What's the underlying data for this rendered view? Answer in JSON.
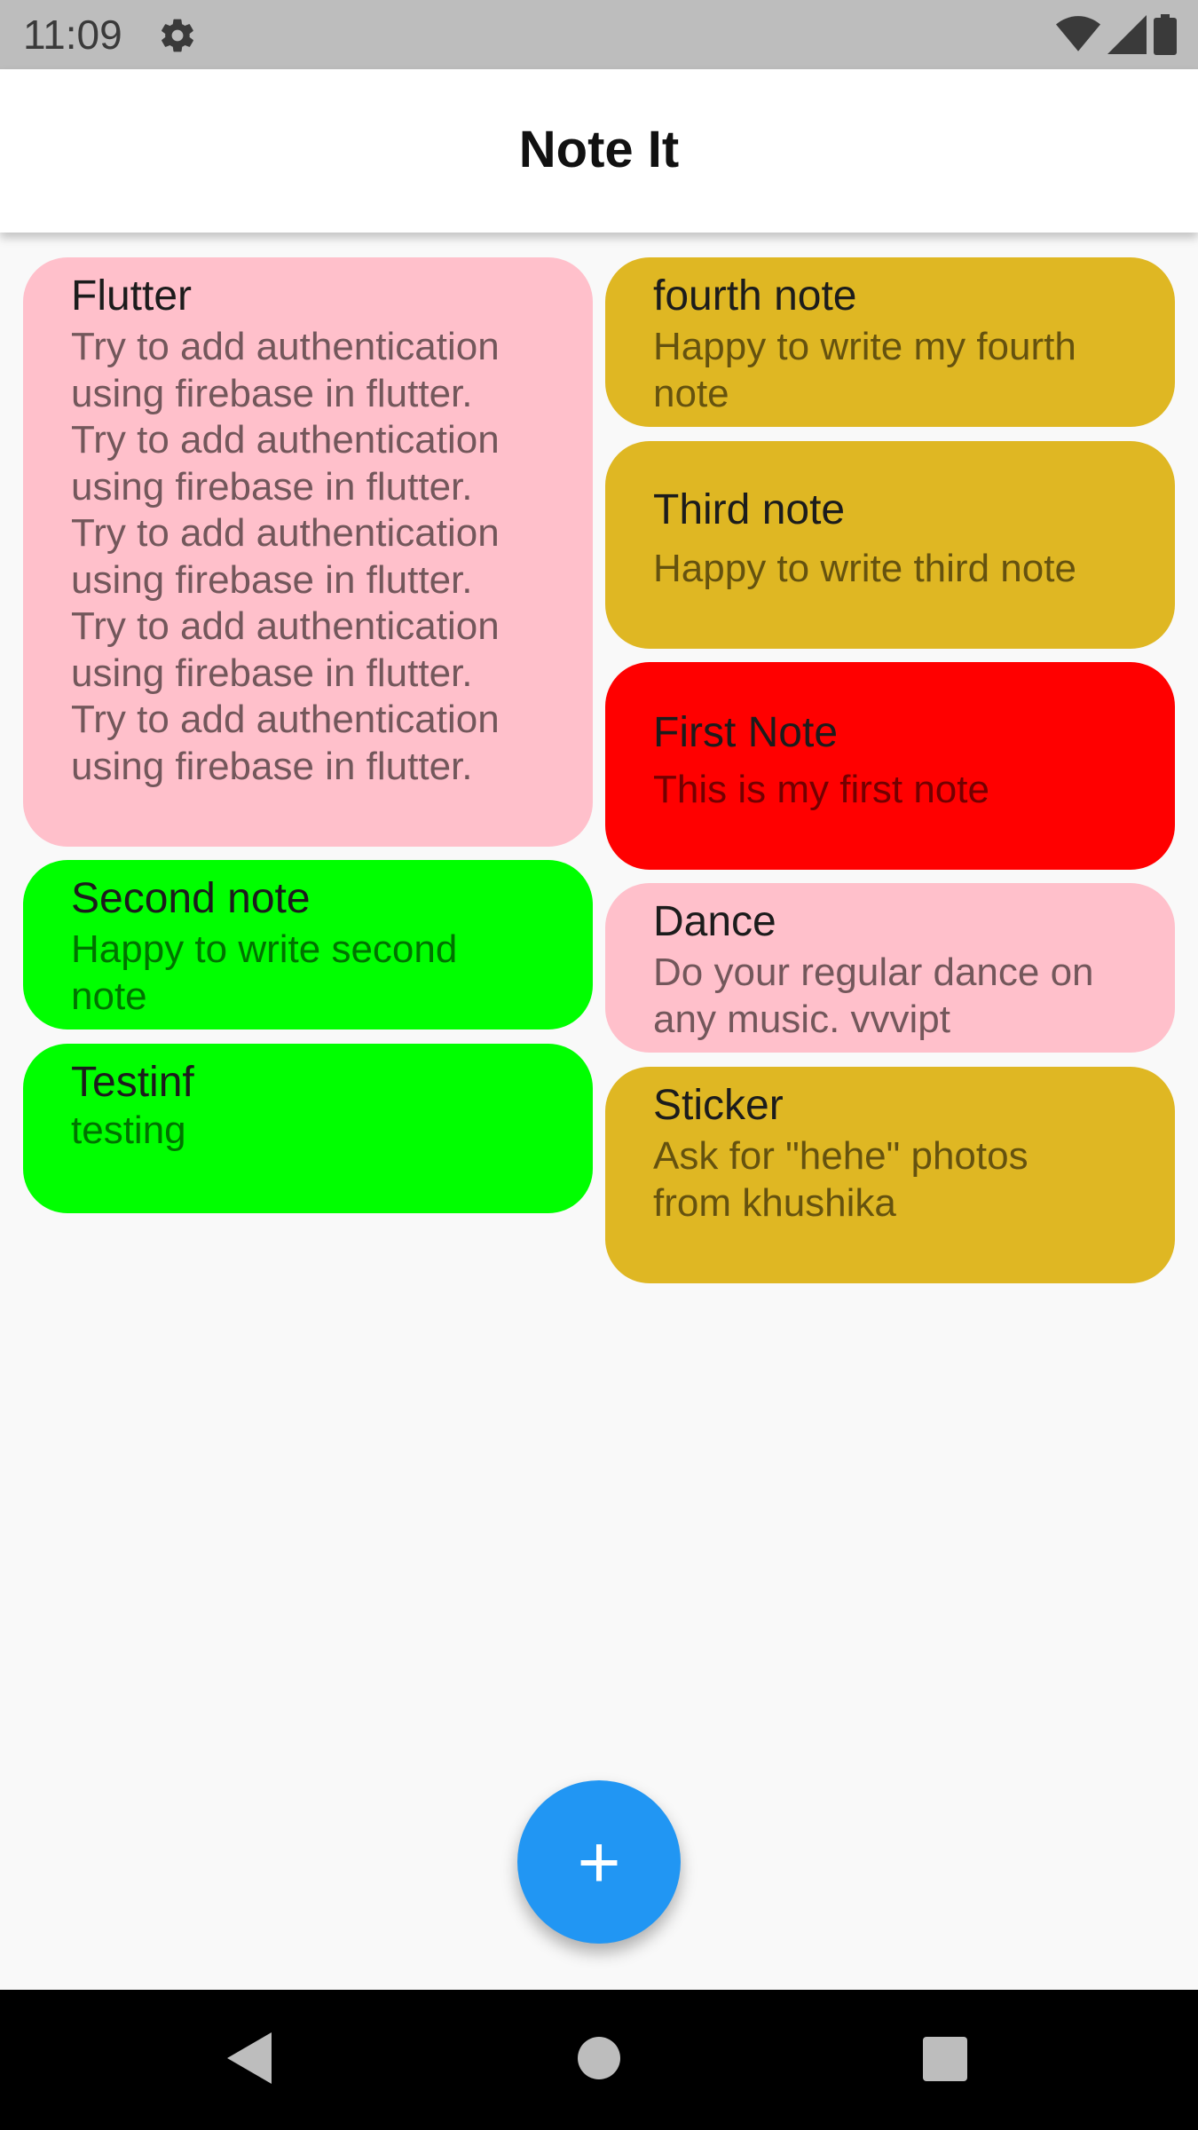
{
  "status_bar": {
    "time": "11:09",
    "icons": [
      "settings-icon",
      "wifi-icon",
      "cell-signal-icon",
      "battery-icon"
    ]
  },
  "app_bar": {
    "title": "Note It"
  },
  "notes": [
    {
      "title": "Flutter",
      "body": "Try to add authentication\nusing firebase in flutter.\nTry to add authentication\nusing firebase in flutter.\n Try to add authentication\nusing firebase in flutter.\nTry to add authentication\nusing firebase in flutter.\nTry to add authentication\nusing firebase in flutter.",
      "color": "#ffc0cb"
    },
    {
      "title": "Second note",
      "body": "Happy to write second\nnote",
      "color": "#00ff00"
    },
    {
      "title": "Testinf",
      "body": "testing",
      "color": "#00ff00"
    },
    {
      "title": "fourth note",
      "body": "Happy to write my fourth\nnote",
      "color": "#dfb723"
    },
    {
      "title": "Third note",
      "body": "Happy to write third note",
      "color": "#dfb723"
    },
    {
      "title": "First Note",
      "body": "This is my first note",
      "color": "#ff0000"
    },
    {
      "title": "Dance",
      "body": "Do your regular dance on\nany music. vvvipt",
      "color": "#ffc0cb"
    },
    {
      "title": "Sticker",
      "body": "Ask for \"hehe\" photos\nfrom khushika",
      "color": "#dfb723"
    }
  ],
  "fab": {
    "icon": "plus-icon",
    "label": "+",
    "color": "#2196f3"
  },
  "nav_bar": {
    "icons": [
      "back-icon",
      "home-icon",
      "recents-icon"
    ]
  }
}
